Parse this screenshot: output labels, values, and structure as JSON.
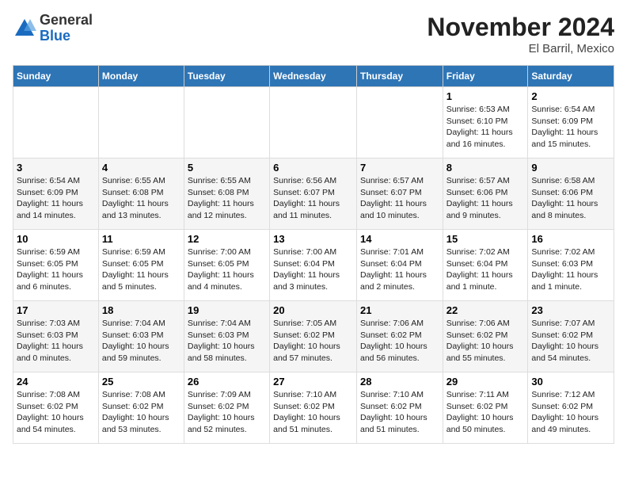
{
  "header": {
    "logo": {
      "general": "General",
      "blue": "Blue"
    },
    "title": "November 2024",
    "location": "El Barril, Mexico"
  },
  "weekdays": [
    "Sunday",
    "Monday",
    "Tuesday",
    "Wednesday",
    "Thursday",
    "Friday",
    "Saturday"
  ],
  "weeks": [
    [
      {
        "day": "",
        "info": ""
      },
      {
        "day": "",
        "info": ""
      },
      {
        "day": "",
        "info": ""
      },
      {
        "day": "",
        "info": ""
      },
      {
        "day": "",
        "info": ""
      },
      {
        "day": "1",
        "info": "Sunrise: 6:53 AM\nSunset: 6:10 PM\nDaylight: 11 hours and 16 minutes."
      },
      {
        "day": "2",
        "info": "Sunrise: 6:54 AM\nSunset: 6:09 PM\nDaylight: 11 hours and 15 minutes."
      }
    ],
    [
      {
        "day": "3",
        "info": "Sunrise: 6:54 AM\nSunset: 6:09 PM\nDaylight: 11 hours and 14 minutes."
      },
      {
        "day": "4",
        "info": "Sunrise: 6:55 AM\nSunset: 6:08 PM\nDaylight: 11 hours and 13 minutes."
      },
      {
        "day": "5",
        "info": "Sunrise: 6:55 AM\nSunset: 6:08 PM\nDaylight: 11 hours and 12 minutes."
      },
      {
        "day": "6",
        "info": "Sunrise: 6:56 AM\nSunset: 6:07 PM\nDaylight: 11 hours and 11 minutes."
      },
      {
        "day": "7",
        "info": "Sunrise: 6:57 AM\nSunset: 6:07 PM\nDaylight: 11 hours and 10 minutes."
      },
      {
        "day": "8",
        "info": "Sunrise: 6:57 AM\nSunset: 6:06 PM\nDaylight: 11 hours and 9 minutes."
      },
      {
        "day": "9",
        "info": "Sunrise: 6:58 AM\nSunset: 6:06 PM\nDaylight: 11 hours and 8 minutes."
      }
    ],
    [
      {
        "day": "10",
        "info": "Sunrise: 6:59 AM\nSunset: 6:05 PM\nDaylight: 11 hours and 6 minutes."
      },
      {
        "day": "11",
        "info": "Sunrise: 6:59 AM\nSunset: 6:05 PM\nDaylight: 11 hours and 5 minutes."
      },
      {
        "day": "12",
        "info": "Sunrise: 7:00 AM\nSunset: 6:05 PM\nDaylight: 11 hours and 4 minutes."
      },
      {
        "day": "13",
        "info": "Sunrise: 7:00 AM\nSunset: 6:04 PM\nDaylight: 11 hours and 3 minutes."
      },
      {
        "day": "14",
        "info": "Sunrise: 7:01 AM\nSunset: 6:04 PM\nDaylight: 11 hours and 2 minutes."
      },
      {
        "day": "15",
        "info": "Sunrise: 7:02 AM\nSunset: 6:04 PM\nDaylight: 11 hours and 1 minute."
      },
      {
        "day": "16",
        "info": "Sunrise: 7:02 AM\nSunset: 6:03 PM\nDaylight: 11 hours and 1 minute."
      }
    ],
    [
      {
        "day": "17",
        "info": "Sunrise: 7:03 AM\nSunset: 6:03 PM\nDaylight: 11 hours and 0 minutes."
      },
      {
        "day": "18",
        "info": "Sunrise: 7:04 AM\nSunset: 6:03 PM\nDaylight: 10 hours and 59 minutes."
      },
      {
        "day": "19",
        "info": "Sunrise: 7:04 AM\nSunset: 6:03 PM\nDaylight: 10 hours and 58 minutes."
      },
      {
        "day": "20",
        "info": "Sunrise: 7:05 AM\nSunset: 6:02 PM\nDaylight: 10 hours and 57 minutes."
      },
      {
        "day": "21",
        "info": "Sunrise: 7:06 AM\nSunset: 6:02 PM\nDaylight: 10 hours and 56 minutes."
      },
      {
        "day": "22",
        "info": "Sunrise: 7:06 AM\nSunset: 6:02 PM\nDaylight: 10 hours and 55 minutes."
      },
      {
        "day": "23",
        "info": "Sunrise: 7:07 AM\nSunset: 6:02 PM\nDaylight: 10 hours and 54 minutes."
      }
    ],
    [
      {
        "day": "24",
        "info": "Sunrise: 7:08 AM\nSunset: 6:02 PM\nDaylight: 10 hours and 54 minutes."
      },
      {
        "day": "25",
        "info": "Sunrise: 7:08 AM\nSunset: 6:02 PM\nDaylight: 10 hours and 53 minutes."
      },
      {
        "day": "26",
        "info": "Sunrise: 7:09 AM\nSunset: 6:02 PM\nDaylight: 10 hours and 52 minutes."
      },
      {
        "day": "27",
        "info": "Sunrise: 7:10 AM\nSunset: 6:02 PM\nDaylight: 10 hours and 51 minutes."
      },
      {
        "day": "28",
        "info": "Sunrise: 7:10 AM\nSunset: 6:02 PM\nDaylight: 10 hours and 51 minutes."
      },
      {
        "day": "29",
        "info": "Sunrise: 7:11 AM\nSunset: 6:02 PM\nDaylight: 10 hours and 50 minutes."
      },
      {
        "day": "30",
        "info": "Sunrise: 7:12 AM\nSunset: 6:02 PM\nDaylight: 10 hours and 49 minutes."
      }
    ]
  ]
}
